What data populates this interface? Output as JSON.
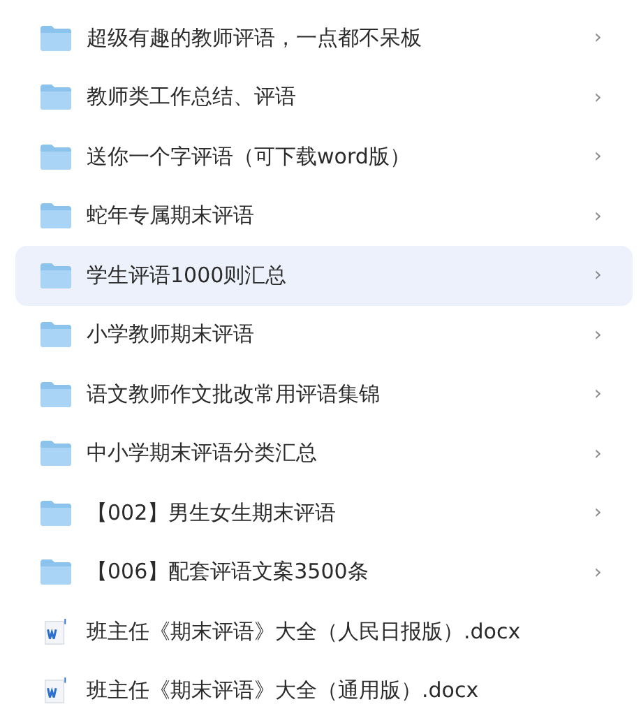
{
  "items": [
    {
      "kind": "folder",
      "name": "超级有趣的教师评语，一点都不呆板",
      "chevron": "›",
      "selected": false
    },
    {
      "kind": "folder",
      "name": "教师类工作总结、评语",
      "chevron": "›",
      "selected": false
    },
    {
      "kind": "folder",
      "name": "送你一个字评语（可下载word版）",
      "chevron": "›",
      "selected": false
    },
    {
      "kind": "folder",
      "name": "蛇年专属期末评语",
      "chevron": "›",
      "selected": false
    },
    {
      "kind": "folder",
      "name": "学生评语1000则汇总",
      "chevron": "›",
      "selected": true
    },
    {
      "kind": "folder",
      "name": "小学教师期末评语",
      "chevron": "›",
      "selected": false
    },
    {
      "kind": "folder",
      "name": "语文教师作文批改常用评语集锦",
      "chevron": "›",
      "selected": false
    },
    {
      "kind": "folder",
      "name": "中小学期末评语分类汇总",
      "chevron": "›",
      "selected": false
    },
    {
      "kind": "folder",
      "name": "【002】男生女生期末评语",
      "chevron": "›",
      "selected": false
    },
    {
      "kind": "folder",
      "name": "【006】配套评语文案3500条",
      "chevron": "›",
      "selected": false
    },
    {
      "kind": "file",
      "name": "班主任《期末评语》大全（人民日报版）.docx",
      "selected": false
    },
    {
      "kind": "file",
      "name": "班主任《期末评语》大全（通用版）.docx",
      "selected": false
    }
  ]
}
